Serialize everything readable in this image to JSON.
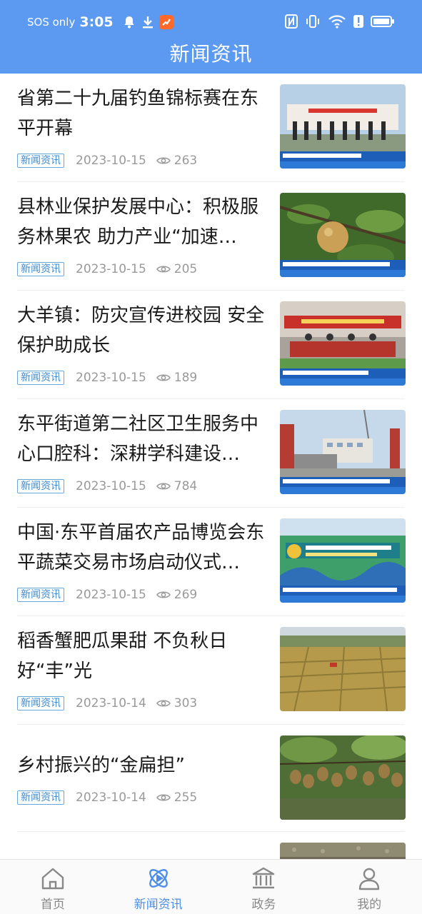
{
  "status_bar": {
    "network": "SOS only",
    "time": "3:05"
  },
  "header": {
    "title": "新闻资讯"
  },
  "colors": {
    "accent": "#5b9af0",
    "tag": "#3d8bd0",
    "meta": "#9a9a9a"
  },
  "news": [
    {
      "title": "省第二十九届钓鱼锦标赛在东平开幕",
      "tag": "新闻资讯",
      "date": "2023-10-15",
      "views": "263",
      "thumb": "ceremony-stage"
    },
    {
      "title": "县林业保护发展中心：积极服务林果农 助力产业“加速…",
      "tag": "新闻资讯",
      "date": "2023-10-15",
      "views": "205",
      "thumb": "pear-on-tree"
    },
    {
      "title": "大羊镇：防灾宣传进校园 安全保护助成长",
      "tag": "新闻资讯",
      "date": "2023-10-15",
      "views": "189",
      "thumb": "school-drill"
    },
    {
      "title": "东平街道第二社区卫生服务中心口腔科：深耕学科建设…",
      "tag": "新闻资讯",
      "date": "2023-10-15",
      "views": "784",
      "thumb": "gate-building"
    },
    {
      "title": "中国·东平首届农产品博览会东平蔬菜交易市场启动仪式…",
      "tag": "新闻资讯",
      "date": "2023-10-15",
      "views": "269",
      "thumb": "expo-arch"
    },
    {
      "title": "稻香蟹肥瓜果甜 不负秋日好“丰”光",
      "tag": "新闻资讯",
      "date": "2023-10-14",
      "views": "303",
      "thumb": "farm-fields"
    },
    {
      "title": "乡村振兴的“金扁担”",
      "tag": "新闻资讯",
      "date": "2023-10-14",
      "views": "255",
      "thumb": "kiwi-orchard"
    }
  ],
  "tabbar": {
    "tabs": [
      {
        "label": "首页",
        "icon": "home-icon"
      },
      {
        "label": "新闻资讯",
        "icon": "news-icon"
      },
      {
        "label": "政务",
        "icon": "government-icon"
      },
      {
        "label": "我的",
        "icon": "profile-icon"
      }
    ],
    "active_index": 1
  }
}
